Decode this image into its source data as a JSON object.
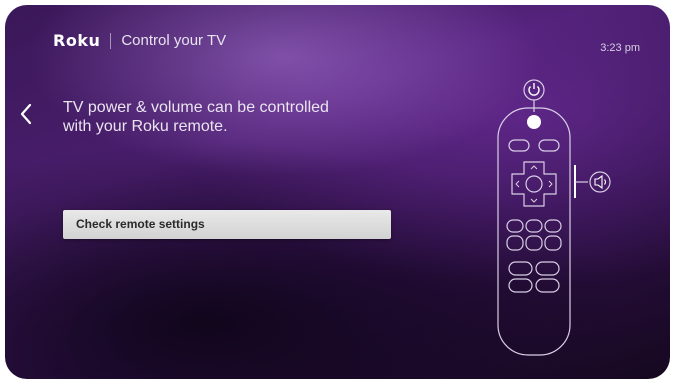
{
  "header": {
    "logo": "Roku",
    "title": "Control your TV",
    "time": "3:23 pm"
  },
  "back_icon": "chevron-left-icon",
  "main": {
    "message_lines": [
      "TV power & volume can be controlled",
      "with your Roku remote."
    ],
    "button_label": "Check remote settings"
  },
  "remote_illustration": {
    "icons": [
      "power-icon",
      "volume-icon"
    ]
  },
  "colors": {
    "background": "#3a1858",
    "text": "#eae4f0",
    "button": "#dcdcdc"
  }
}
